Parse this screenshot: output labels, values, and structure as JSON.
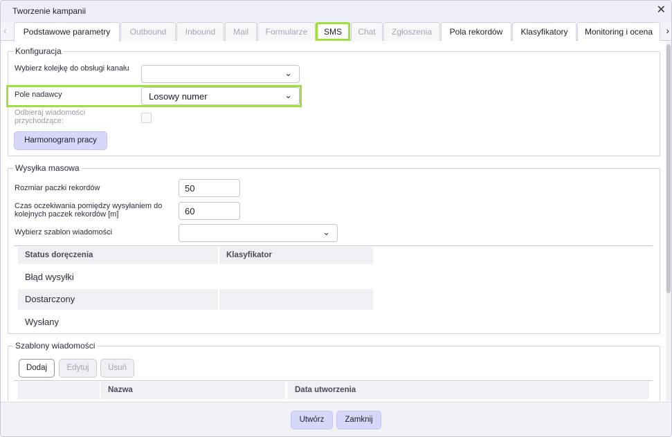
{
  "window": {
    "title": "Tworzenie kampanii",
    "close": "✕"
  },
  "tabs": {
    "items": [
      {
        "label": "Podstawowe parametry"
      },
      {
        "label": "Outbound"
      },
      {
        "label": "Inbound"
      },
      {
        "label": "Mail"
      },
      {
        "label": "Formularze"
      },
      {
        "label": "SMS"
      },
      {
        "label": "Chat"
      },
      {
        "label": "Zgłoszenia"
      },
      {
        "label": "Pola rekordów"
      },
      {
        "label": "Klasyfikatory"
      },
      {
        "label": "Monitoring i ocena"
      }
    ],
    "prev_arrow": "‹",
    "next_arrow": "›"
  },
  "config": {
    "legend": "Konfiguracja",
    "queue_label": "Wybierz kolejkę do obsługi kanału",
    "queue_value": "",
    "sender_label": "Pole nadawcy",
    "sender_value": "Losowy numer",
    "incoming_label": "Odbieraj wiadomości przychodzące:",
    "schedule_button": "Harmonogram pracy"
  },
  "mass": {
    "legend": "Wysyłka masowa",
    "batch_label": "Rozmiar paczki rekordów",
    "batch_value": "50",
    "wait_label": "Czas oczekiwania pomiędzy wysyłaniem do kolejnych paczek rekordów [m]",
    "wait_value": "60",
    "template_label": "Wybierz szablon wiadomości",
    "template_value": "",
    "table": {
      "headers": [
        "Status doręczenia",
        "Klasyfikator"
      ],
      "rows": [
        {
          "status": "Błąd wysyłki",
          "classifier": ""
        },
        {
          "status": "Dostarczony",
          "classifier": ""
        },
        {
          "status": "Wysłany",
          "classifier": ""
        }
      ]
    }
  },
  "templates": {
    "legend": "Szablony wiadomości",
    "add": "Dodaj",
    "edit": "Edytuj",
    "delete": "Usuń",
    "headers": [
      "Nazwa",
      "Data utworzenia"
    ]
  },
  "footer": {
    "create": "Utwórz",
    "close": "Zamknij"
  },
  "icons": {
    "chevron": "chevron-down-icon"
  },
  "colors": {
    "highlight": "#9ee03b",
    "accent": "#d7d7fa"
  }
}
